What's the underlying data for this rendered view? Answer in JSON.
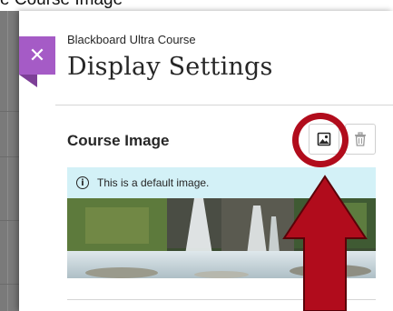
{
  "top_cropped_text": "e Course Image",
  "panel": {
    "close_glyph": "✕",
    "close_icon": "close-icon",
    "subtitle": "Blackboard Ultra Course",
    "title": "Display Settings"
  },
  "course_image_section": {
    "heading": "Course Image",
    "edit_icon": "image-edit-icon",
    "delete_icon": "trash-icon",
    "info_icon": "info-icon",
    "info_text": "This is a default image.",
    "image_subject": "waterfall"
  },
  "annotation": {
    "ring_color": "#b10c1c",
    "arrow_color": "#b10c1c"
  },
  "colors": {
    "close_button": "#a55bc6",
    "info_banner": "#d3f1f7"
  }
}
